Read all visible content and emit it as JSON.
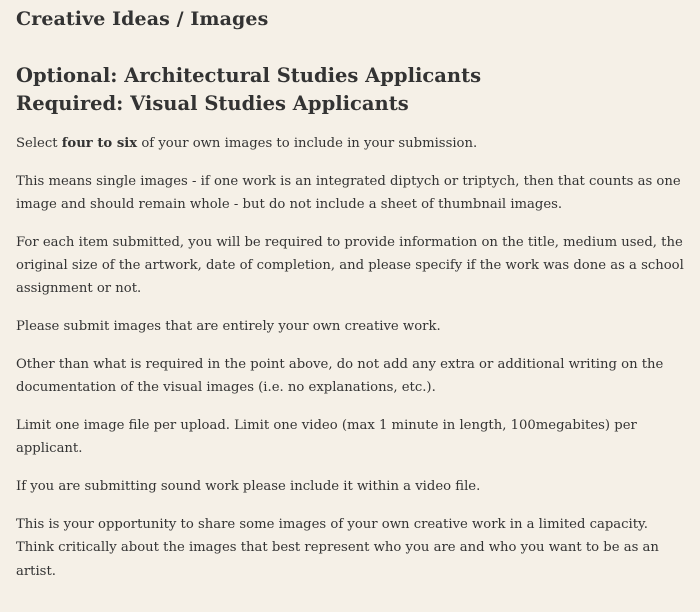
{
  "section_title": "Creative Ideas / Images",
  "headings": [
    "Optional: Architectural Studies Applicants",
    "Required: Visual Studies Applicants"
  ],
  "intro": {
    "before": "Select ",
    "bold": "four to six",
    "after": " of your own images to include in your submission."
  },
  "paragraphs": [
    "This means single images - if one work is an integrated diptych or triptych, then that counts as one image and should remain whole - but do not include a sheet of thumbnail images.",
    "For each item submitted, you will be required to provide information on the title, medium used, the original size of the artwork, date of completion, and please specify if the work was done as a school assignment or not.",
    "Please submit images that are entirely your own creative work.",
    "Other than what is required in the point above, do not add any extra or additional writing on the documentation of the visual images (i.e. no explanations, etc.).",
    "Limit one image file per upload. Limit one video (max 1 minute in length, 100megabites) per applicant.",
    "If you are submitting sound work please include it within a video file.",
    "This is your opportunity to share some images of your own creative work in a limited capacity. Think critically about the images that best represent who you are and who you want to be as an artist."
  ]
}
